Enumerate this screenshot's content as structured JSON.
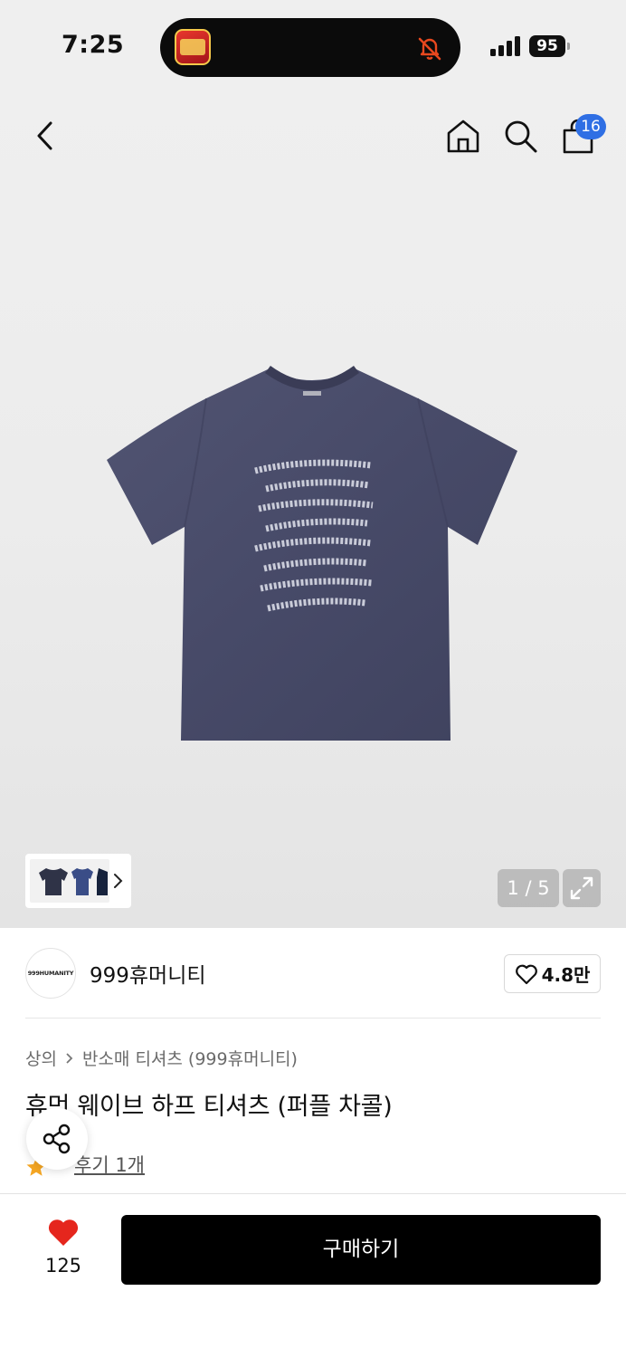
{
  "status_bar": {
    "time": "7:25",
    "battery": "95"
  },
  "top_nav": {
    "cart_count": "16"
  },
  "gallery": {
    "counter": "1 / 5"
  },
  "brand": {
    "logo_text": "999HUMANITY",
    "name": "999휴머니티",
    "likes": "4.8만"
  },
  "breadcrumb": {
    "category": "상의",
    "subcategory": "반소매 티셔츠 (999휴머니티)"
  },
  "product": {
    "title": "휴먼 웨이브 하프 티셔츠 (퍼플 차콜)",
    "review_link": "후기 1개"
  },
  "bottom_bar": {
    "wish_count": "125",
    "buy_label": "구매하기"
  },
  "colors": {
    "accent_badge": "#2f6fe4",
    "wish_heart": "#e5261d",
    "star": "#f5a623",
    "buy_button": "#000000",
    "shirt": "#4a4d6b"
  }
}
